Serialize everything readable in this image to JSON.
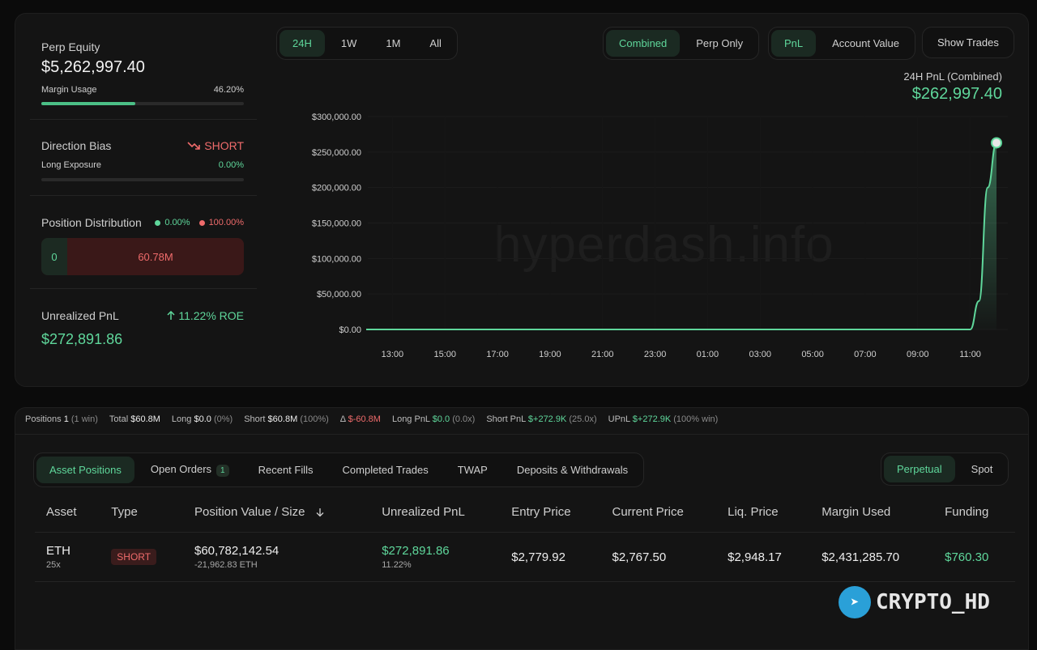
{
  "left": {
    "perp_equity_label": "Perp Equity",
    "perp_equity_value": "$5,262,997.40",
    "margin_usage_label": "Margin Usage",
    "margin_usage_value": "46.20%",
    "margin_usage_fraction": 0.462,
    "direction_bias_label": "Direction Bias",
    "direction_bias_value": "SHORT",
    "direction_bias_icon": "trend-down-icon",
    "long_exposure_label": "Long Exposure",
    "long_exposure_value": "0.00%",
    "long_exposure_fraction": 0.0,
    "position_distribution_label": "Position Distribution",
    "dist_long_pct": "0.00%",
    "dist_short_pct": "100.00%",
    "dist_long_value": "0",
    "dist_short_value": "60.78M",
    "unrealized_pnl_label": "Unrealized PnL",
    "roe_text": "11.22% ROE",
    "roe_icon": "arrow-up-icon",
    "unrealized_pnl_value": "$272,891.86"
  },
  "controls": {
    "ranges": [
      "24H",
      "1W",
      "1M",
      "All"
    ],
    "range_active": "24H",
    "scope": [
      "Combined",
      "Perp Only"
    ],
    "scope_active": "Combined",
    "metric": [
      "PnL",
      "Account Value"
    ],
    "metric_active": "PnL",
    "show_trades": "Show Trades"
  },
  "pnl_header": {
    "title": "24H PnL (Combined)",
    "value": "$262,997.40"
  },
  "watermark": "hyperdash.info",
  "chart_data": {
    "type": "area",
    "title": "",
    "xlabel": "",
    "ylabel": "",
    "y_ticks": [
      "$300,000.00",
      "$250,000.00",
      "$200,000.00",
      "$150,000.00",
      "$100,000.00",
      "$50,000.00",
      "$0.00"
    ],
    "x_ticks": [
      "13:00",
      "15:00",
      "17:00",
      "19:00",
      "21:00",
      "23:00",
      "01:00",
      "03:00",
      "05:00",
      "07:00",
      "09:00",
      "11:00"
    ],
    "ylim": [
      0,
      300000
    ],
    "grid": true,
    "color": "#5fd79b",
    "series": [
      {
        "x": [
          "12:00",
          "13:00",
          "15:00",
          "17:00",
          "19:00",
          "21:00",
          "23:00",
          "01:00",
          "03:00",
          "05:00",
          "07:00",
          "09:00",
          "11:00",
          "11:20",
          "11:40",
          "12:00"
        ],
        "values": [
          0,
          0,
          0,
          0,
          0,
          0,
          0,
          0,
          0,
          0,
          0,
          0,
          0,
          40000,
          200000,
          262997.4
        ]
      }
    ]
  },
  "summary": {
    "positions_label": "Positions",
    "positions_value": "1",
    "positions_note": "(1 win)",
    "total_label": "Total",
    "total_value": "$60.8M",
    "long_label": "Long",
    "long_value": "$0.0",
    "long_note": "(0%)",
    "short_label": "Short",
    "short_value": "$60.8M",
    "short_note": "(100%)",
    "delta_label": "Δ",
    "delta_value": "$-60.8M",
    "long_pnl_label": "Long PnL",
    "long_pnl_value": "$0.0",
    "long_pnl_note": "(0.0x)",
    "short_pnl_label": "Short PnL",
    "short_pnl_value": "$+272.9K",
    "short_pnl_note": "(25.0x)",
    "upnl_label": "UPnL",
    "upnl_value": "$+272.9K",
    "upnl_note": "(100% win)"
  },
  "tabs": {
    "items": [
      "Asset Positions",
      "Open Orders",
      "Recent Fills",
      "Completed Trades",
      "TWAP",
      "Deposits & Withdrawals"
    ],
    "active": "Asset Positions",
    "open_orders_badge": "1",
    "market": [
      "Perpetual",
      "Spot"
    ],
    "market_active": "Perpetual"
  },
  "table": {
    "headers": [
      "Asset",
      "Type",
      "Position Value / Size",
      "Unrealized PnL",
      "Entry Price",
      "Current Price",
      "Liq. Price",
      "Margin Used",
      "Funding"
    ],
    "sort_icon": "arrow-down-icon",
    "rows": [
      {
        "asset": "ETH",
        "leverage": "25x",
        "type": "SHORT",
        "value": "$60,782,142.54",
        "size": "-21,962.83 ETH",
        "upnl": "$272,891.86",
        "upnl_pct": "11.22%",
        "entry": "$2,779.92",
        "current": "$2,767.50",
        "liq": "$2,948.17",
        "margin": "$2,431,285.70",
        "funding": "$760.30"
      }
    ]
  },
  "overlay_brand": "CRYPTO_HD"
}
